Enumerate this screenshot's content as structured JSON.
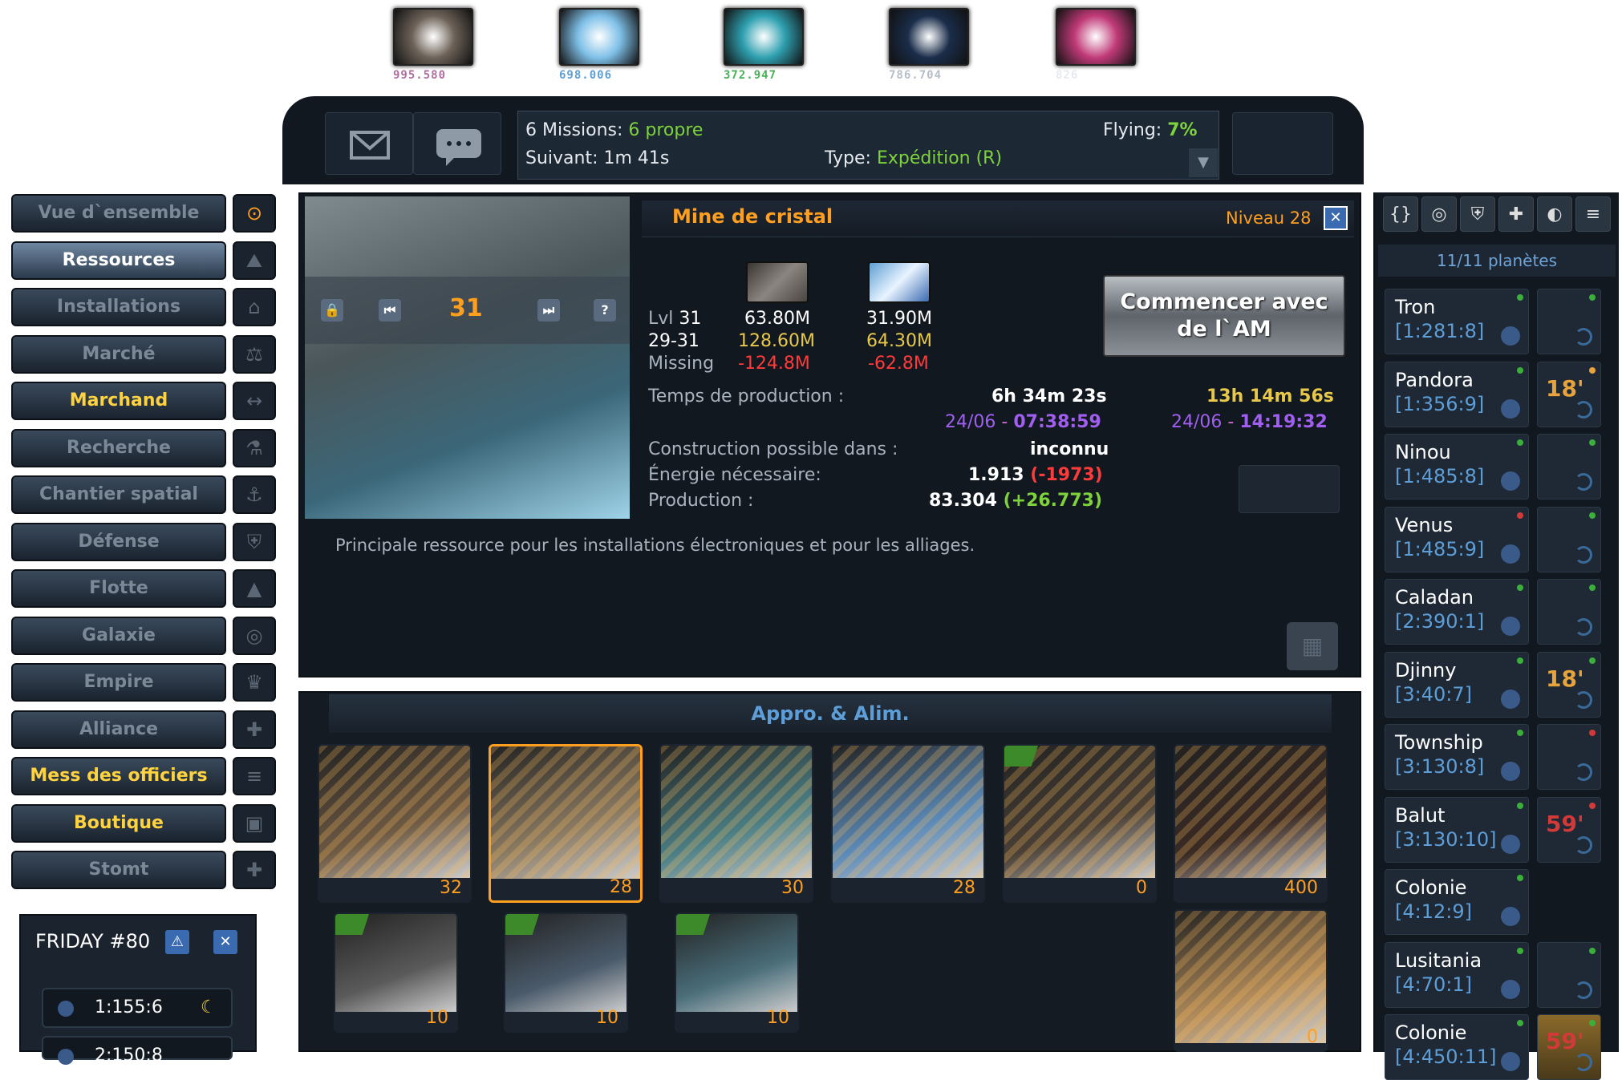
{
  "resources": [
    {
      "name": "metal",
      "value": "995.580",
      "color": "#b06fa0",
      "swatch": "#6d6258"
    },
    {
      "name": "crystal",
      "value": "698.006",
      "color": "#5f9fd3",
      "swatch": "#7fc0e8"
    },
    {
      "name": "deuterium",
      "value": "372.947",
      "color": "#4ab05a",
      "swatch": "#2fa0b0"
    },
    {
      "name": "dark-matter",
      "value": "786.704",
      "color": "#b6bec8",
      "swatch": "#1a2d4a"
    },
    {
      "name": "energy",
      "value": "826",
      "color": "#e6eaef",
      "swatch": "#c03a78"
    }
  ],
  "header": {
    "missions_label": "6 Missions:",
    "missions_value": "6 propre",
    "flying_label": "Flying:",
    "flying_value": "7%",
    "next_label": "Suivant:",
    "next_value": "1m 41s",
    "type_label": "Type:",
    "type_value": "Expédition (R)"
  },
  "menu": [
    {
      "label": "Vue d`ensemble",
      "state": "normal",
      "icon": "⊙"
    },
    {
      "label": "Ressources",
      "state": "active",
      "icon": "⛰"
    },
    {
      "label": "Installations",
      "state": "normal",
      "icon": "⌂"
    },
    {
      "label": "Marché",
      "state": "normal",
      "icon": "⚖"
    },
    {
      "label": "Marchand",
      "state": "yellow",
      "icon": "↔"
    },
    {
      "label": "Recherche",
      "state": "normal",
      "icon": "⚗"
    },
    {
      "label": "Chantier spatial",
      "state": "normal",
      "icon": "⚓"
    },
    {
      "label": "Défense",
      "state": "normal",
      "icon": "⛨"
    },
    {
      "label": "Flotte",
      "state": "normal",
      "icon": "▲"
    },
    {
      "label": "Galaxie",
      "state": "normal",
      "icon": "◎"
    },
    {
      "label": "Empire",
      "state": "normal",
      "icon": "♛"
    },
    {
      "label": "Alliance",
      "state": "normal",
      "icon": "✚"
    },
    {
      "label": "Mess des officiers",
      "state": "yellow",
      "icon": "≡"
    },
    {
      "label": "Boutique",
      "state": "yellow",
      "icon": "▣"
    },
    {
      "label": "Stomt",
      "state": "normal",
      "icon": "✚"
    }
  ],
  "detail": {
    "title": "Mine de cristal",
    "level_label": "Niveau 28",
    "photo_level": "31",
    "row1_label": "Lvl",
    "row1_lvl": "31",
    "row1_metal": "63.80M",
    "row1_crystal": "31.90M",
    "row2_label": "29-31",
    "row2_metal": "128.60M",
    "row2_crystal": "64.30M",
    "row3_label": "Missing",
    "row3_metal": "-124.8M",
    "row3_crystal": "-62.8M",
    "start_button": "Commencer avec de l`AM",
    "prod_time_label": "Temps de production :",
    "prod_time_1": "6h 34m 23s",
    "prod_date_1a": "24/06",
    "prod_date_1sep": " - ",
    "prod_date_1b": "07:38:59",
    "prod_time_2": "13h 14m 56s",
    "prod_date_2a": "24/06",
    "prod_date_2sep": " - ",
    "prod_date_2b": "14:19:32",
    "construct_label": "Construction possible dans :",
    "construct_value": "inconnu",
    "energy_label": "Énergie nécessaire:",
    "energy_value": "1.913",
    "energy_delta": "(-1973)",
    "production_label": "Production :",
    "production_value": "83.304",
    "production_delta": "(+26.773)",
    "description": "Principale ressource pour les installations électroniques et pour les alliages."
  },
  "supply": {
    "title": "Appro. & Alim.",
    "tiles": [
      {
        "level": "32",
        "upgrade": false,
        "selected": false,
        "color": "#6e5a44"
      },
      {
        "level": "28",
        "upgrade": false,
        "selected": true,
        "color": "#8a7a62"
      },
      {
        "level": "30",
        "upgrade": false,
        "selected": false,
        "color": "#4a7e84"
      },
      {
        "level": "28",
        "upgrade": false,
        "selected": false,
        "color": "#5b8ab8"
      },
      {
        "level": "0",
        "upgrade": true,
        "selected": false,
        "color": "#4a4036"
      },
      {
        "level": "400",
        "upgrade": false,
        "selected": false,
        "color": "#3a2a24"
      }
    ],
    "tiles_row2": [
      {
        "level": "10",
        "upgrade": true,
        "color": "#5a5a5a"
      },
      {
        "level": "10",
        "upgrade": true,
        "color": "#4a5a6a"
      },
      {
        "level": "10",
        "upgrade": true,
        "color": "#4a6e7a"
      },
      {
        "level": "0",
        "upgrade": false,
        "color": "#b08a5a"
      }
    ]
  },
  "sidebar": {
    "count_label": "11/11 planètes",
    "icons": [
      "{}",
      "◎",
      "⛨",
      "✚",
      "◐",
      "≡"
    ],
    "planets": [
      {
        "name": "Tron",
        "coords": "[1:281:8]",
        "dot": "#3ab03a",
        "moon": true,
        "moon_dot": "#3ab03a",
        "moon_text": "",
        "moon_color": ""
      },
      {
        "name": "Pandora",
        "coords": "[1:356:9]",
        "dot": "#3ab03a",
        "moon": true,
        "moon_dot": "#e8a33a",
        "moon_text": "18'",
        "moon_color": "orange"
      },
      {
        "name": "Ninou",
        "coords": "[1:485:8]",
        "dot": "#3ab03a",
        "moon": true,
        "moon_dot": "#3ab03a",
        "moon_text": "",
        "moon_color": ""
      },
      {
        "name": "Venus",
        "coords": "[1:485:9]",
        "dot": "#d23a3a",
        "moon": true,
        "moon_dot": "#3ab03a",
        "moon_text": "",
        "moon_color": ""
      },
      {
        "name": "Caladan",
        "coords": "[2:390:1]",
        "dot": "#3ab03a",
        "moon": true,
        "moon_dot": "#3ab03a",
        "moon_text": "",
        "moon_color": ""
      },
      {
        "name": "Djinny",
        "coords": "[3:40:7]",
        "dot": "#3ab03a",
        "moon": true,
        "moon_dot": "#3ab03a",
        "moon_text": "18'",
        "moon_color": "orange"
      },
      {
        "name": "Township",
        "coords": "[3:130:8]",
        "dot": "#3ab03a",
        "moon": true,
        "moon_dot": "#d23a3a",
        "moon_text": "",
        "moon_color": ""
      },
      {
        "name": "Balut",
        "coords": "[3:130:10]",
        "dot": "#3ab03a",
        "moon": true,
        "moon_dot": "#d23a3a",
        "moon_text": "59'",
        "moon_color": "red"
      },
      {
        "name": "Colonie",
        "coords": "[4:12:9]",
        "dot": "#3ab03a",
        "moon": false,
        "moon_dot": "",
        "moon_text": "",
        "moon_color": ""
      },
      {
        "name": "Lusitania",
        "coords": "[4:70:1]",
        "dot": "#3ab03a",
        "moon": true,
        "moon_dot": "#3ab03a",
        "moon_text": "",
        "moon_color": ""
      },
      {
        "name": "Colonie",
        "coords": "[4:450:11]",
        "dot": "#3ab03a",
        "moon": true,
        "moon_dot": "#3ab03a",
        "moon_text": "59'",
        "moon_color": "red"
      }
    ]
  },
  "friday": {
    "title": "FRIDAY #80",
    "rows": [
      "1:155:6",
      "2:150:8"
    ]
  }
}
